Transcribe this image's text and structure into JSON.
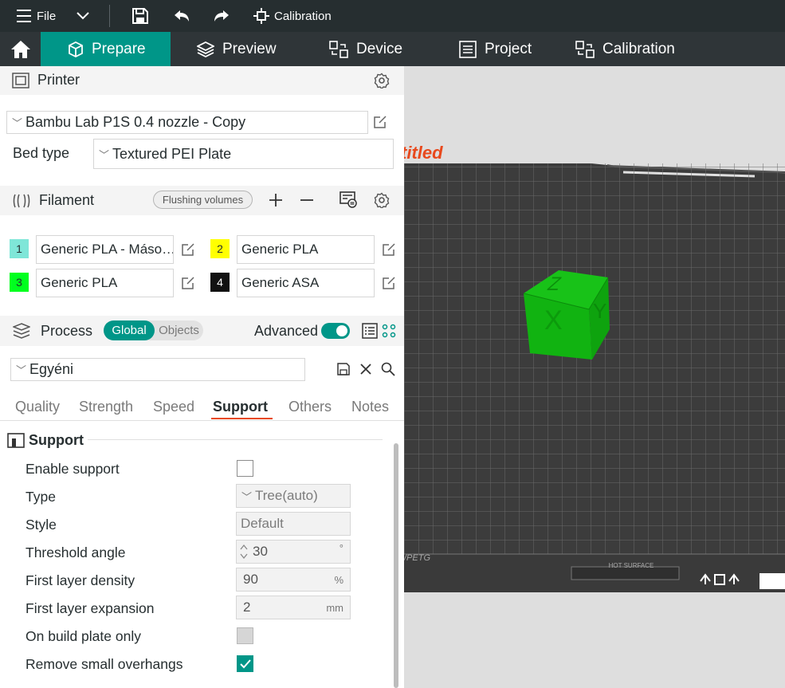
{
  "menubar": {
    "file_label": "File",
    "calibration_label": "Calibration"
  },
  "tabs": [
    {
      "label": "Prepare",
      "icon": "cube-icon"
    },
    {
      "label": "Preview",
      "icon": "layers-icon"
    },
    {
      "label": "Device",
      "icon": "device-icon"
    },
    {
      "label": "Project",
      "icon": "list-icon"
    },
    {
      "label": "Calibration",
      "icon": "calibration-icon"
    }
  ],
  "printer": {
    "title": "Printer",
    "name": "Bambu Lab P1S 0.4 nozzle - Copy",
    "bed_type_label": "Bed type",
    "bed_type_value": "Textured PEI Plate"
  },
  "filament": {
    "title": "Filament",
    "flushing_label": "Flushing volumes",
    "items": [
      {
        "num": "1",
        "name": "Generic PLA - Máso…",
        "color": "#7fe6d8",
        "num_color": "#262e30"
      },
      {
        "num": "2",
        "name": "Generic PLA",
        "color": "#ffff00",
        "num_color": "#262e30"
      },
      {
        "num": "3",
        "name": "Generic PLA",
        "color": "#00ff1f",
        "num_color": "#262e30"
      },
      {
        "num": "4",
        "name": "Generic ASA",
        "color": "#111111",
        "num_color": "#ffffff"
      }
    ]
  },
  "process": {
    "title": "Process",
    "global_label": "Global",
    "objects_label": "Objects",
    "advanced_label": "Advanced",
    "preset": "Egyéni",
    "tabs": [
      "Quality",
      "Strength",
      "Speed",
      "Support",
      "Others",
      "Notes"
    ],
    "active_tab": "Support"
  },
  "support": {
    "section_title": "Support",
    "enable_support": "Enable support",
    "type_label": "Type",
    "type_value": "Tree(auto)",
    "style_label": "Style",
    "style_value": "Default",
    "threshold_label": "Threshold angle",
    "threshold_value": "30",
    "threshold_unit": "°",
    "first_density_label": "First layer density",
    "first_density_value": "90",
    "first_density_unit": "%",
    "first_expansion_label": "First layer expansion",
    "first_expansion_value": "2",
    "first_expansion_unit": "mm",
    "build_plate_label": "On build plate only",
    "overhangs_label": "Remove small overhangs"
  },
  "viewport": {
    "plate_name": "titled",
    "plate_text": "/PETG",
    "surface_text": "HOT SURFACE",
    "cube_top": "Z",
    "cube_front": "X",
    "cube_side": "Y"
  },
  "colors": {
    "accent": "#009688",
    "menubar": "#262e30",
    "tabbar": "#2f3538",
    "cube": "#14b814",
    "plate": "#3c3c3c",
    "plate_name": "#e8491d"
  }
}
